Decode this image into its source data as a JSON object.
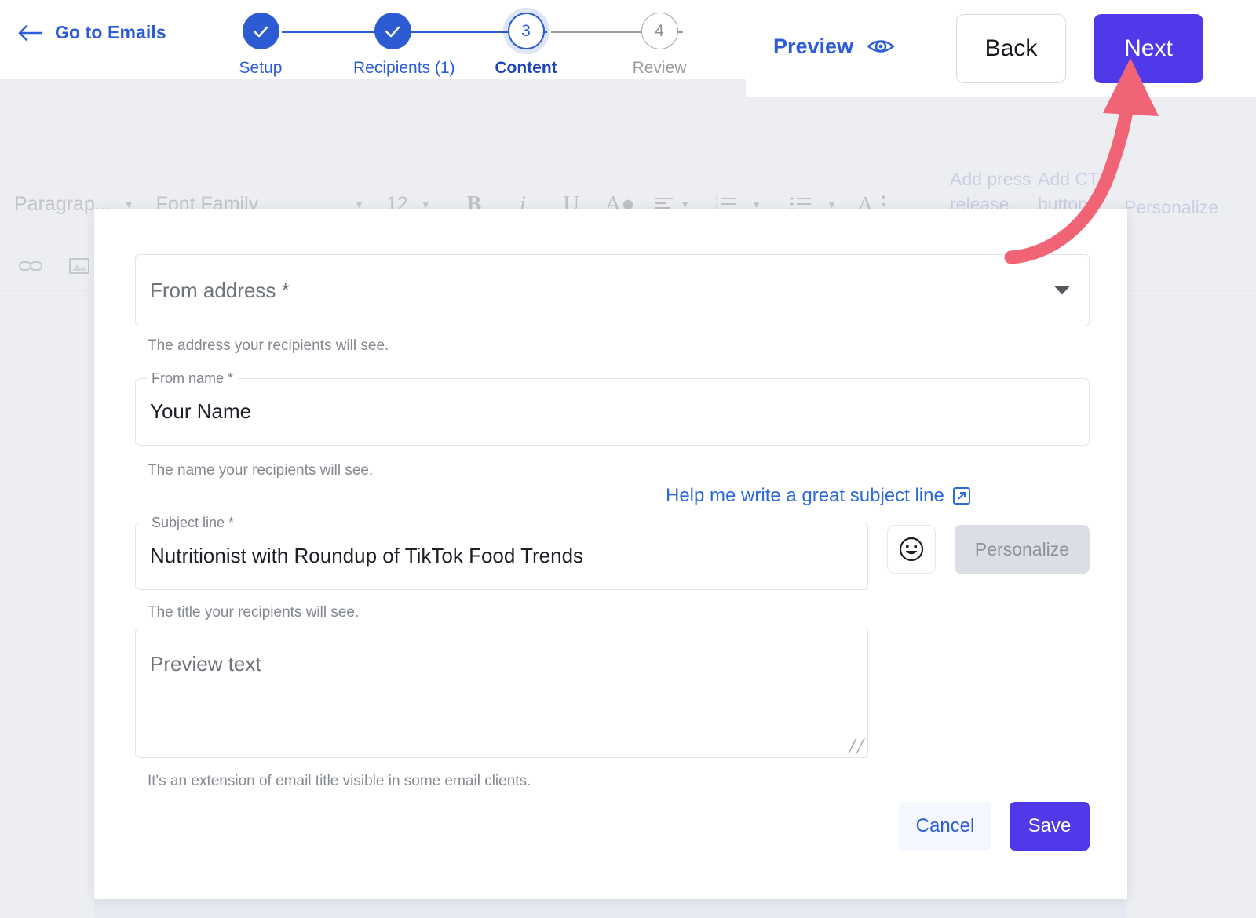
{
  "header": {
    "back_link": "Go to Emails",
    "back_icon": "arrow-left-icon",
    "preview_label": "Preview",
    "preview_icon": "eye-icon",
    "back_button": "Back",
    "next_button": "Next",
    "next_button_color": "#4f39e8",
    "accent_blue": "#2d5cd9"
  },
  "stepper": {
    "steps": [
      {
        "id": "setup",
        "number": "1",
        "label": "Setup",
        "state": "done",
        "mark": "✓"
      },
      {
        "id": "recipients",
        "number": "2",
        "label": "Recipients (1)",
        "state": "done",
        "mark": "✓"
      },
      {
        "id": "content",
        "number": "3",
        "label": "Content",
        "state": "active",
        "mark": "3"
      },
      {
        "id": "review",
        "number": "4",
        "label": "Review",
        "state": "todo",
        "mark": "4"
      }
    ]
  },
  "editor_toolbar": {
    "row1": [
      {
        "name": "paragraph-style-select",
        "label": "Paragrap...",
        "caret": true
      },
      {
        "name": "font-family-select",
        "label": "Font Family",
        "caret": true
      },
      {
        "name": "font-size-select",
        "label": "12",
        "caret": true
      },
      {
        "name": "bold-button",
        "icon": "bold-icon"
      },
      {
        "name": "italic-button",
        "icon": "italic-icon"
      },
      {
        "name": "underline-button",
        "icon": "underline-icon"
      },
      {
        "name": "text-color-button",
        "icon": "text-color-icon"
      },
      {
        "name": "align-button",
        "icon": "align-left-icon",
        "caret": true
      },
      {
        "name": "ordered-list-button",
        "icon": "ordered-list-icon",
        "caret": true
      },
      {
        "name": "bullet-list-button",
        "icon": "bullet-list-icon",
        "caret": true
      },
      {
        "name": "line-height-button",
        "icon": "line-height-icon"
      }
    ],
    "row2": [
      {
        "name": "insert-link-button",
        "icon": "link-icon"
      },
      {
        "name": "insert-image-button",
        "icon": "image-icon"
      },
      {
        "name": "insert-file-button",
        "icon": "file-icon"
      },
      {
        "name": "insert-emoji-button",
        "icon": "emoji-icon"
      },
      {
        "name": "insert-more-button",
        "icon": "plus-list-icon"
      },
      {
        "name": "undo-button",
        "icon": "undo-icon"
      },
      {
        "name": "redo-button",
        "icon": "redo-icon"
      }
    ],
    "side_actions": [
      {
        "name": "add-press-release-button",
        "label": "Add press release"
      },
      {
        "name": "add-cta-button",
        "label": "Add CTA button"
      },
      {
        "name": "personalize-button",
        "label": "Personalize"
      }
    ]
  },
  "form": {
    "from_address": {
      "label": "From address *",
      "value": "",
      "placeholder": "From address *",
      "helper": "The address your recipients will see."
    },
    "from_name": {
      "label": "From name *",
      "value": "Your Name",
      "helper": "The name your recipients will see."
    },
    "subject": {
      "help_link": "Help me write a great subject line",
      "help_link_icon": "external-link-icon",
      "label": "Subject line *",
      "value": "Nutritionist with Roundup of TikTok Food Trends",
      "helper": "The title your recipients will see.",
      "emoji_button_icon": "smiley-icon",
      "personalize_label": "Personalize"
    },
    "preview_text": {
      "placeholder": "Preview text",
      "value": "",
      "helper": "It's an extension of email title visible in some email clients."
    },
    "actions": {
      "cancel_label": "Cancel",
      "save_label": "Save",
      "save_color": "#4f39e8",
      "cancel_color": "#2d5cd9"
    }
  },
  "annotation": {
    "arrow_name": "red-annotation-arrow",
    "arrow_color": "#f06476",
    "points_to": "Next"
  }
}
